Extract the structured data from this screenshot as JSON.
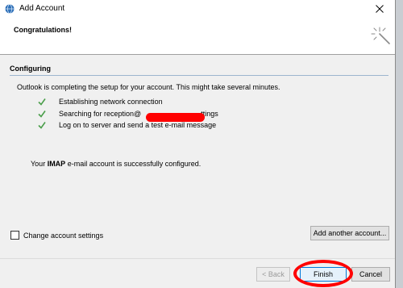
{
  "window": {
    "title": "Add Account"
  },
  "header": {
    "title": "Congratulations!"
  },
  "section": {
    "title": "Configuring"
  },
  "intro": "Outlook is completing the setup for your account. This might take several minutes.",
  "steps": [
    {
      "label": "Establishing network connection",
      "status": "done"
    },
    {
      "label": "Searching for reception@",
      "label_tail": "ttings",
      "status": "done"
    },
    {
      "label": "Log on to server and send a test e-mail message",
      "status": "done"
    }
  ],
  "success": {
    "prefix": "Your ",
    "account_type": "IMAP",
    "suffix": " e-mail account is successfully configured."
  },
  "options": {
    "change_settings_label": "Change account settings",
    "change_settings_checked": false
  },
  "buttons": {
    "add_another": "Add another account...",
    "back": "< Back",
    "finish": "Finish",
    "cancel": "Cancel"
  },
  "colors": {
    "check": "#4a9e4a",
    "annotation": "#ff0000",
    "accent": "#0078d7"
  }
}
